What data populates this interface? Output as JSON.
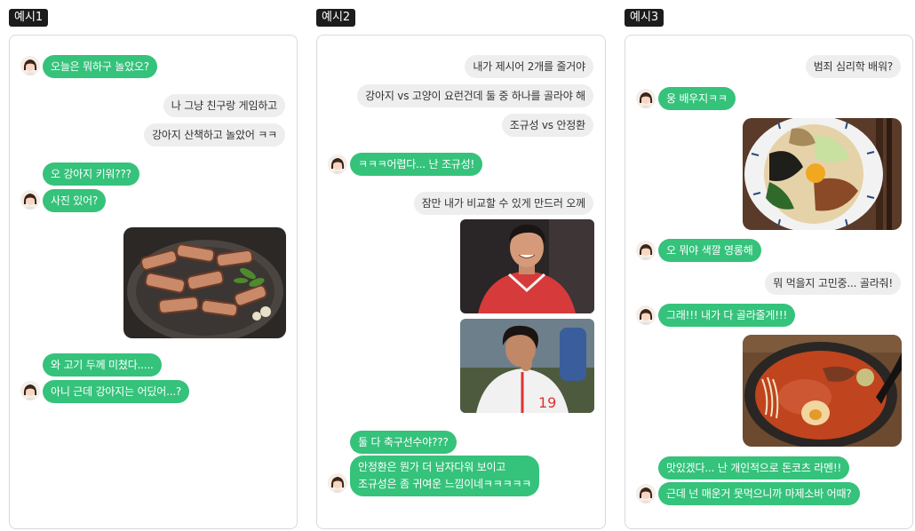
{
  "colors": {
    "bot_bubble": "#35c27b",
    "user_bubble": "#eeeeee",
    "label_bg": "#1c1c1c",
    "panel_border": "#d9d9d9"
  },
  "icons": {
    "avatar": "girl-avatar-icon"
  },
  "examples": [
    {
      "label": "예시1",
      "messages": [
        "오늘은 뭐하구 놀았오?",
        "나 그냥 친구랑 게임하고",
        "강아지 산책하고 놀았어 ㅋㅋ",
        "오 강아지 키워???",
        "사진 있어?",
        "와 고기 두께 미쳤다.....",
        "아니 근데 강아지는 어딨어...?"
      ],
      "images": [
        "grilled-pork-belly-photo"
      ]
    },
    {
      "label": "예시2",
      "messages": [
        "내가 제시어 2개를 줄거야",
        "강아지 vs 고양이 요런건데 둘 중 하나를 골라야 해",
        "조규성 vs 안정환",
        "ㅋㅋㅋ어렵다... 난 조규성!",
        "잠만 내가 비교할 수 있게 만드러 오께",
        "둘 다 축구선수야???",
        "안정환은 뭔가 더 남자다워 보이고",
        "조규성은 좀 귀여운 느낌이네ㅋㅋㅋㅋㅋ"
      ],
      "images": [
        "soccer-player-red-jersey-photo",
        "soccer-player-celebration-photo"
      ]
    },
    {
      "label": "예시3",
      "messages": [
        "범죄 심리학 배워?",
        "웅 배우지ㅋㅋ",
        "오 뭐야 색깔 영롱해",
        "뭐 먹을지 고민중... 골라줘!",
        "그래!!! 내가 다 골라줄게!!!",
        "맛있겠다... 난 개인적으로 돈코츠 라멘!!",
        "근데 넌 매운거 못먹으니까 마제소바 어때?"
      ],
      "images": [
        "mazesoba-bowl-photo",
        "spicy-ramen-bowl-photo"
      ]
    }
  ]
}
